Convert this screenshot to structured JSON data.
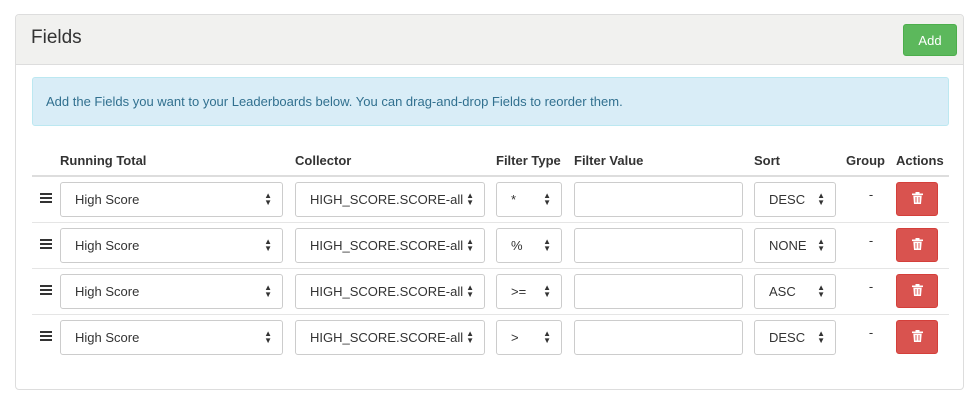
{
  "panel": {
    "title": "Fields",
    "add_label": "Add"
  },
  "alert": {
    "text": "Add the Fields you want to your Leaderboards below. You can drag-and-drop Fields to reorder them."
  },
  "table": {
    "headers": {
      "running_total": "Running Total",
      "collector": "Collector",
      "filter_type": "Filter Type",
      "filter_value": "Filter Value",
      "sort": "Sort",
      "group": "Group",
      "actions": "Actions"
    },
    "rows": [
      {
        "running_total": "High Score",
        "collector": "HIGH_SCORE.SCORE-all",
        "filter_type": "*",
        "filter_value": "",
        "sort": "DESC",
        "group": "-"
      },
      {
        "running_total": "High Score",
        "collector": "HIGH_SCORE.SCORE-all",
        "filter_type": "%",
        "filter_value": "",
        "sort": "NONE",
        "group": "-"
      },
      {
        "running_total": "High Score",
        "collector": "HIGH_SCORE.SCORE-all",
        "filter_type": ">=",
        "filter_value": "",
        "sort": "ASC",
        "group": "-"
      },
      {
        "running_total": "High Score",
        "collector": "HIGH_SCORE.SCORE-all",
        "filter_type": ">",
        "filter_value": "",
        "sort": "DESC",
        "group": "-"
      }
    ]
  },
  "icons": {
    "handle": "drag-handle-icon",
    "select_arrows": "sort-arrows-icon",
    "delete": "trash-icon"
  },
  "colors": {
    "add_button": "#5cb85c",
    "delete_button": "#d9534f",
    "alert_bg": "#d9edf7",
    "alert_text": "#31708f",
    "heading_bg": "#f1f1ef"
  }
}
